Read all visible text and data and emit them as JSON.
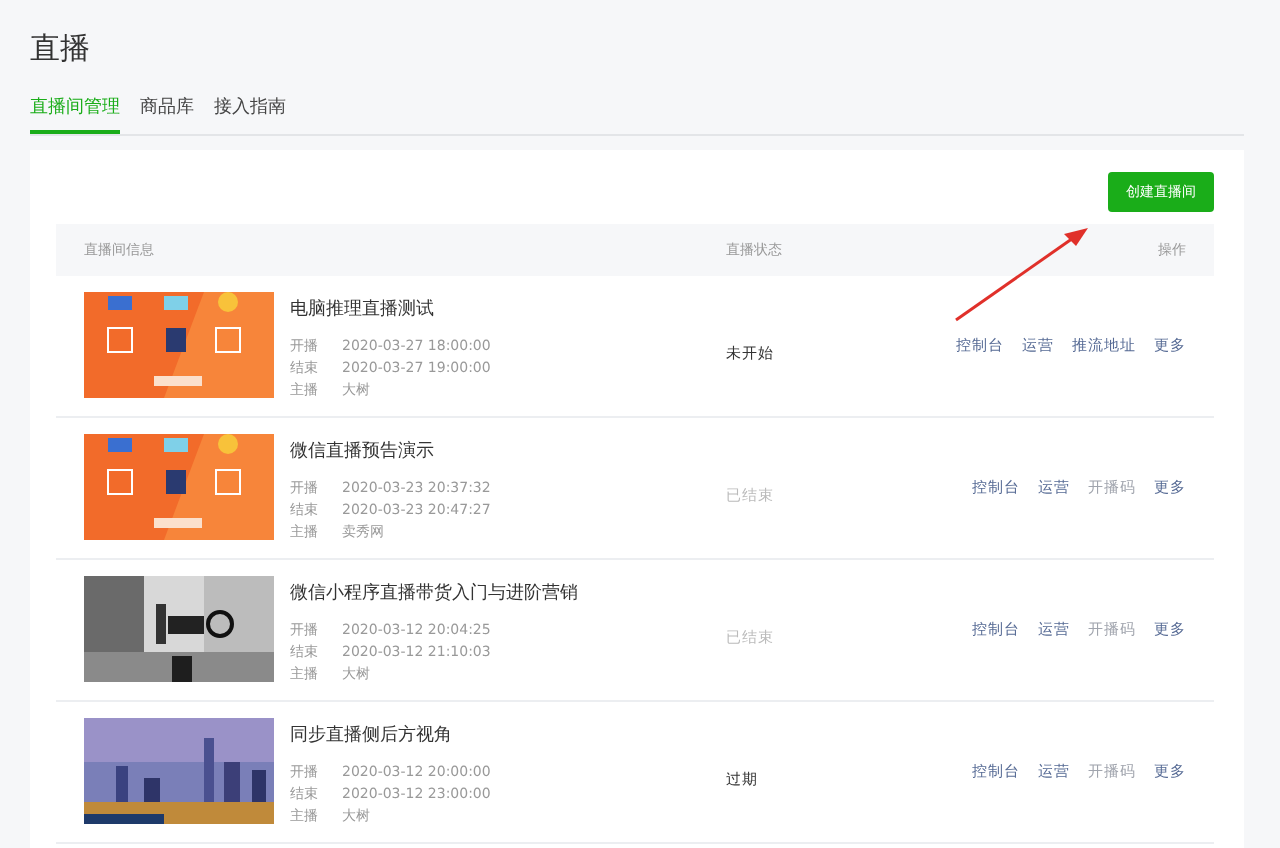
{
  "page_title": "直播",
  "tabs": [
    {
      "label": "直播间管理",
      "selected": true
    },
    {
      "label": "商品库",
      "selected": false
    },
    {
      "label": "接入指南",
      "selected": false
    }
  ],
  "create_button": "创建直播间",
  "table": {
    "columns": [
      "直播间信息",
      "直播状态",
      "操作"
    ],
    "rows": [
      {
        "thumbnail": {
          "kind": "promo"
        },
        "title": "电脑推理直播测试",
        "details": [
          {
            "label": "开播",
            "value": "2020-03-27 18:00:00"
          },
          {
            "label": "结束",
            "value": "2020-03-27 19:00:00"
          },
          {
            "label": "主播",
            "value": "大树"
          }
        ],
        "status": "未开始",
        "status_muted": false,
        "actions": [
          {
            "label": "控制台",
            "disabled": false
          },
          {
            "label": "运营",
            "disabled": false
          },
          {
            "label": "推流地址",
            "disabled": false
          },
          {
            "label": "更多",
            "disabled": false
          }
        ]
      },
      {
        "thumbnail": {
          "kind": "promo"
        },
        "title": "微信直播预告演示",
        "details": [
          {
            "label": "开播",
            "value": "2020-03-23 20:37:32"
          },
          {
            "label": "结束",
            "value": "2020-03-23 20:47:27"
          },
          {
            "label": "主播",
            "value": "卖秀网"
          }
        ],
        "status": "已结束",
        "status_muted": true,
        "actions": [
          {
            "label": "控制台",
            "disabled": false
          },
          {
            "label": "运营",
            "disabled": false
          },
          {
            "label": "开播码",
            "disabled": true
          },
          {
            "label": "更多",
            "disabled": false
          }
        ]
      },
      {
        "thumbnail": {
          "kind": "studio"
        },
        "title": "微信小程序直播带货入门与进阶营销",
        "details": [
          {
            "label": "开播",
            "value": "2020-03-12 20:04:25"
          },
          {
            "label": "结束",
            "value": "2020-03-12 21:10:03"
          },
          {
            "label": "主播",
            "value": "大树"
          }
        ],
        "status": "已结束",
        "status_muted": true,
        "actions": [
          {
            "label": "控制台",
            "disabled": false
          },
          {
            "label": "运营",
            "disabled": false
          },
          {
            "label": "开播码",
            "disabled": true
          },
          {
            "label": "更多",
            "disabled": false
          }
        ]
      },
      {
        "thumbnail": {
          "kind": "city"
        },
        "title": "同步直播侧后方视角",
        "details": [
          {
            "label": "开播",
            "value": "2020-03-12 20:00:00"
          },
          {
            "label": "结束",
            "value": "2020-03-12 23:00:00"
          },
          {
            "label": "主播",
            "value": "大树"
          }
        ],
        "status": "过期",
        "status_muted": false,
        "actions": [
          {
            "label": "控制台",
            "disabled": false
          },
          {
            "label": "运营",
            "disabled": false
          },
          {
            "label": "开播码",
            "disabled": true
          },
          {
            "label": "更多",
            "disabled": false
          }
        ]
      }
    ]
  }
}
